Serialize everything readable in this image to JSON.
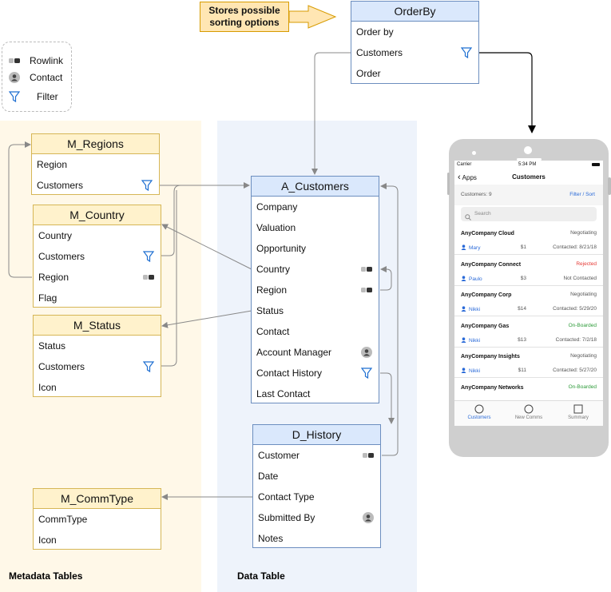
{
  "callout": {
    "line1": "Stores possible",
    "line2": "sorting options"
  },
  "legend": {
    "rowlink": "Rowlink",
    "contact": "Contact",
    "filter": "Filter"
  },
  "zones": {
    "metadata": "Metadata Tables",
    "data": "Data Table"
  },
  "tables": {
    "orderby": {
      "title": "OrderBy",
      "rows": [
        "Order by",
        "Customers",
        "Order"
      ]
    },
    "m_regions": {
      "title": "M_Regions",
      "rows": [
        "Region",
        "Customers"
      ]
    },
    "m_country": {
      "title": "M_Country",
      "rows": [
        "Country",
        "Customers",
        "Region",
        "Flag"
      ]
    },
    "m_status": {
      "title": "M_Status",
      "rows": [
        "Status",
        "Customers",
        "Icon"
      ]
    },
    "m_commtype": {
      "title": "M_CommType",
      "rows": [
        "CommType",
        "Icon"
      ]
    },
    "a_customers": {
      "title": "A_Customers",
      "rows": [
        "Company",
        "Valuation",
        "Opportunity",
        "Country",
        "Region",
        "Status",
        "Contact",
        "Account Manager",
        "Contact History",
        "Last Contact"
      ]
    },
    "d_history": {
      "title": "D_History",
      "rows": [
        "Customer",
        "Date",
        "Contact Type",
        "Submitted By",
        "Notes"
      ]
    }
  },
  "icons": {
    "filter": "filter-icon",
    "rowlink": "rowlink-icon",
    "contact": "contact-icon"
  },
  "colors": {
    "yellow_fill": "#fff2cc",
    "yellow_border": "#d6b656",
    "blue_fill": "#dae8fc",
    "blue_border": "#6c8ebf",
    "filter_blue": "#1f6fd1",
    "arrow_gray": "#888888",
    "rejected": "#e53935",
    "onboarded": "#2e9b3a",
    "link_blue": "#2a6ad8"
  },
  "phone": {
    "status": {
      "carrier": "Carrier",
      "time": "5:34 PM"
    },
    "nav": {
      "back": "Apps",
      "title": "Customers"
    },
    "subhead": {
      "count": "Customers: 9",
      "action": "Filter / Sort"
    },
    "search_placeholder": "Search",
    "items": [
      {
        "name": "AnyCompany Cloud",
        "status": "Negotiating",
        "status_color": "#555555",
        "contact": "Mary",
        "amount": "$1",
        "contacted": "Contacted: 8/21/18"
      },
      {
        "name": "AnyCompany Connect",
        "status": "Rejected",
        "status_color": "#e53935",
        "contact": "Paulo",
        "amount": "$3",
        "contacted": "Not Contacted"
      },
      {
        "name": "AnyCompany Corp",
        "status": "Negotiating",
        "status_color": "#555555",
        "contact": "Nikki",
        "amount": "$14",
        "contacted": "Contacted: 5/29/20"
      },
      {
        "name": "AnyCompany Gas",
        "status": "On-Boarded",
        "status_color": "#2e9b3a",
        "contact": "Nikki",
        "amount": "$13",
        "contacted": "Contacted: 7/2/18"
      },
      {
        "name": "AnyCompany Insights",
        "status": "Negotiating",
        "status_color": "#555555",
        "contact": "Nikki",
        "amount": "$11",
        "contacted": "Contacted: 5/27/20"
      },
      {
        "name": "AnyCompany Networks",
        "status": "On-Boarded",
        "status_color": "#2e9b3a",
        "contact": "",
        "amount": "",
        "contacted": ""
      }
    ],
    "tabs": [
      "Customers",
      "New Comms",
      "Summary"
    ]
  }
}
